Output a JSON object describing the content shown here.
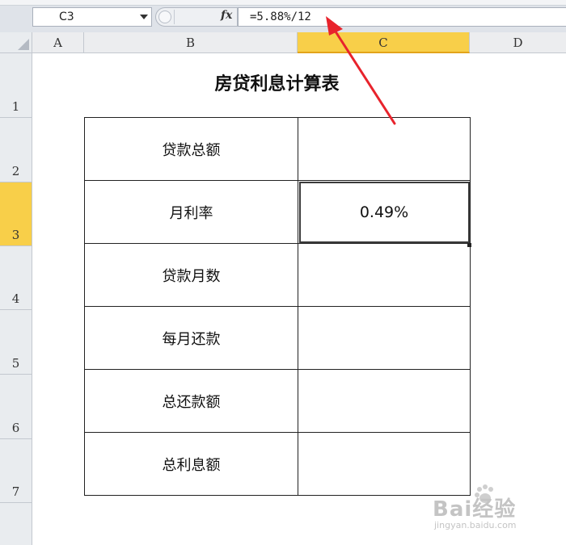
{
  "formula_bar": {
    "name_box": "C3",
    "fx_label": "fx",
    "formula": "=5.88%/12"
  },
  "columns": [
    "A",
    "B",
    "C",
    "D"
  ],
  "active_column": "C",
  "rows": [
    "1",
    "2",
    "3",
    "4",
    "5",
    "6",
    "7"
  ],
  "active_row": "3",
  "sheet": {
    "title": "房贷利息计算表",
    "table": [
      {
        "label": "贷款总额",
        "value": ""
      },
      {
        "label": "月利率",
        "value": "0.49%"
      },
      {
        "label": "贷款月数",
        "value": ""
      },
      {
        "label": "每月还款",
        "value": ""
      },
      {
        "label": "总还款额",
        "value": ""
      },
      {
        "label": "总利息额",
        "value": ""
      }
    ]
  },
  "watermark": {
    "brand": "Bai经验",
    "url": "jingyan.baidu.com"
  },
  "colors": {
    "active_header": "#f8cf49",
    "annotation_arrow": "#e8232c"
  },
  "icons": {
    "name_box_dropdown": "chevron-down-icon",
    "function": "fx-icon",
    "select_all": "select-all-icon",
    "annotation": "red-arrow-icon"
  }
}
